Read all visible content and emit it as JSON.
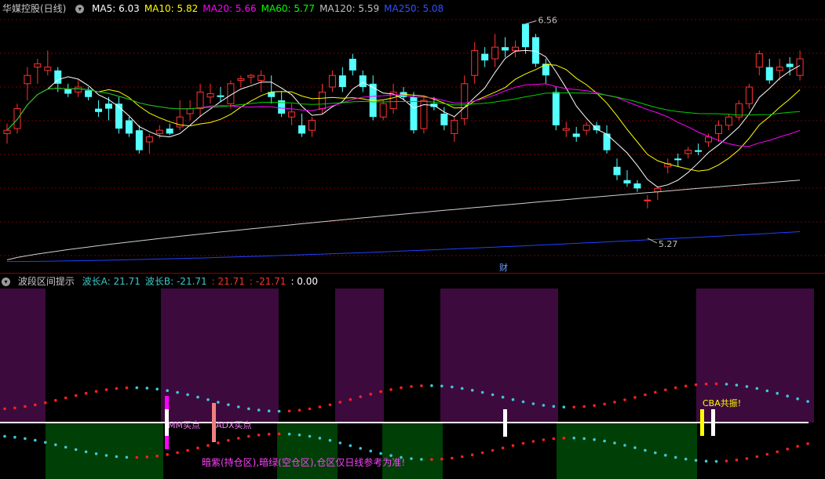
{
  "main_panel": {
    "title": "华媒控股(日线)",
    "ma": [
      {
        "label": "MA5: 6.03",
        "color": "#ffffff"
      },
      {
        "label": "MA10: 5.82",
        "color": "#ffff00"
      },
      {
        "label": "MA20: 5.66",
        "color": "#ff00ff"
      },
      {
        "label": "MA60: 5.77",
        "color": "#00ff00"
      },
      {
        "label": "MA120: 5.59",
        "color": "#c0c0c0"
      },
      {
        "label": "MA250: 5.08",
        "color": "#3050ff"
      }
    ],
    "high_label": "6.56",
    "low_label": "5.27",
    "finance_marker": "财"
  },
  "sub_panel": {
    "title": "波段区间提示",
    "values": [
      {
        "label": "波长A: 21.71",
        "color": "#3cc8c8"
      },
      {
        "label": "波长B: -21.71",
        "color": "#3cc8c8"
      },
      {
        "label": ": 21.71",
        "color": "#ff3030"
      },
      {
        "label": ": -21.71",
        "color": "#ff3030"
      },
      {
        "label": ": 0.00",
        "color": "#ffffff"
      }
    ],
    "signal_mm": "MM买点",
    "signal_adx": "ADX买点",
    "signal_cba": "CBA共振!",
    "note": "暗紫(持仓区),暗绿(空仓区),仓区仅日线参考为准!"
  },
  "chart_data": {
    "type": "candlestick",
    "y_range": [
      5.1,
      6.6
    ],
    "high": 6.56,
    "low": 5.27,
    "up_color": "#ff3232",
    "down_color": "#54ffff",
    "candles": [
      [
        5.9,
        5.96,
        5.84,
        5.92
      ],
      [
        5.93,
        6.08,
        5.9,
        6.05
      ],
      [
        6.2,
        6.3,
        6.1,
        6.25
      ],
      [
        6.3,
        6.35,
        6.2,
        6.32
      ],
      [
        6.28,
        6.4,
        6.25,
        6.3
      ],
      [
        6.28,
        6.3,
        6.15,
        6.2
      ],
      [
        6.17,
        6.2,
        6.12,
        6.14
      ],
      [
        6.15,
        6.22,
        6.12,
        6.18
      ],
      [
        6.16,
        6.18,
        6.1,
        6.12
      ],
      [
        6.05,
        6.1,
        6.0,
        6.03
      ],
      [
        6.08,
        6.12,
        5.98,
        6.05
      ],
      [
        6.08,
        6.12,
        5.9,
        5.93
      ],
      [
        5.98,
        6.0,
        5.88,
        5.9
      ],
      [
        5.92,
        5.95,
        5.78,
        5.8
      ],
      [
        5.85,
        5.9,
        5.78,
        5.88
      ],
      [
        5.9,
        5.95,
        5.87,
        5.92
      ],
      [
        5.93,
        5.96,
        5.89,
        5.9
      ],
      [
        5.94,
        6.1,
        5.92,
        6.0
      ],
      [
        6.02,
        6.1,
        5.98,
        6.05
      ],
      [
        6.05,
        6.2,
        6.0,
        6.15
      ],
      [
        6.12,
        6.2,
        6.08,
        6.14
      ],
      [
        6.13,
        6.18,
        6.09,
        6.12
      ],
      [
        6.08,
        6.22,
        6.05,
        6.2
      ],
      [
        6.22,
        6.25,
        6.18,
        6.23
      ],
      [
        6.24,
        6.26,
        6.2,
        6.25
      ],
      [
        6.22,
        6.28,
        6.15,
        6.25
      ],
      [
        6.15,
        6.25,
        6.08,
        6.12
      ],
      [
        6.1,
        6.15,
        6.0,
        6.02
      ],
      [
        6.0,
        6.08,
        5.95,
        6.03
      ],
      [
        5.95,
        6.02,
        5.88,
        5.9
      ],
      [
        5.92,
        6.0,
        5.88,
        5.98
      ],
      [
        6.05,
        6.2,
        6.02,
        6.15
      ],
      [
        6.18,
        6.28,
        6.15,
        6.25
      ],
      [
        6.25,
        6.3,
        6.15,
        6.18
      ],
      [
        6.35,
        6.38,
        6.25,
        6.28
      ],
      [
        6.25,
        6.28,
        6.15,
        6.18
      ],
      [
        6.2,
        6.25,
        5.98,
        6.0
      ],
      [
        6.0,
        6.1,
        5.98,
        6.08
      ],
      [
        6.05,
        6.2,
        6.02,
        6.15
      ],
      [
        6.15,
        6.18,
        6.1,
        6.12
      ],
      [
        6.12,
        6.15,
        5.9,
        5.92
      ],
      [
        5.93,
        6.12,
        5.9,
        6.1
      ],
      [
        6.08,
        6.12,
        6.04,
        6.06
      ],
      [
        6.02,
        6.06,
        5.92,
        5.95
      ],
      [
        5.9,
        6.0,
        5.85,
        5.98
      ],
      [
        5.99,
        6.25,
        5.95,
        6.2
      ],
      [
        6.25,
        6.45,
        6.2,
        6.4
      ],
      [
        6.38,
        6.42,
        6.3,
        6.34
      ],
      [
        6.35,
        6.5,
        6.3,
        6.42
      ],
      [
        6.42,
        6.48,
        6.36,
        6.4
      ],
      [
        6.4,
        6.46,
        6.36,
        6.42
      ],
      [
        6.56,
        6.56,
        6.38,
        6.42
      ],
      [
        6.48,
        6.5,
        6.3,
        6.32
      ],
      [
        6.32,
        6.35,
        6.2,
        6.25
      ],
      [
        6.15,
        6.18,
        5.92,
        5.95
      ],
      [
        5.92,
        5.97,
        5.88,
        5.93
      ],
      [
        5.9,
        5.94,
        5.85,
        5.88
      ],
      [
        5.92,
        5.97,
        5.89,
        5.95
      ],
      [
        5.95,
        5.97,
        5.9,
        5.92
      ],
      [
        5.9,
        5.95,
        5.78,
        5.8
      ],
      [
        5.7,
        5.75,
        5.62,
        5.65
      ],
      [
        5.62,
        5.68,
        5.58,
        5.6
      ],
      [
        5.6,
        5.62,
        5.55,
        5.57
      ],
      [
        5.5,
        5.53,
        5.45,
        5.5
      ],
      [
        5.55,
        5.58,
        5.5,
        5.57
      ],
      [
        5.7,
        5.75,
        5.66,
        5.72
      ],
      [
        5.75,
        5.78,
        5.7,
        5.74
      ],
      [
        5.78,
        5.82,
        5.75,
        5.8
      ],
      [
        5.8,
        5.84,
        5.77,
        5.79
      ],
      [
        5.85,
        5.9,
        5.82,
        5.88
      ],
      [
        5.9,
        5.98,
        5.85,
        5.95
      ],
      [
        5.95,
        6.02,
        5.92,
        6.0
      ],
      [
        6.0,
        6.1,
        5.98,
        6.08
      ],
      [
        6.08,
        6.2,
        6.05,
        6.18
      ],
      [
        6.3,
        6.4,
        6.25,
        6.38
      ],
      [
        6.3,
        6.35,
        6.2,
        6.22
      ],
      [
        6.28,
        6.35,
        6.22,
        6.3
      ],
      [
        6.32,
        6.36,
        6.25,
        6.3
      ],
      [
        6.25,
        6.4,
        6.22,
        6.35
      ]
    ]
  }
}
